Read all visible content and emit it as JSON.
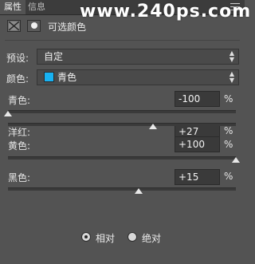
{
  "tabs": [
    {
      "label": "属性",
      "active": true
    },
    {
      "label": "信息",
      "active": false
    }
  ],
  "watermark": "www.240ps.com",
  "header": {
    "title": "可选颜色",
    "adjustment_icon": "selective-color-icon",
    "mask_icon": "layer-mask-icon"
  },
  "preset": {
    "label": "预设:",
    "value": "自定"
  },
  "colors": {
    "label": "颜色:",
    "value": "青色",
    "swatch_color": "#18b2f2"
  },
  "sliders": [
    {
      "label": "青色:",
      "value": "-100",
      "unit": "%",
      "level": -100
    },
    {
      "label": "洋红:",
      "value": "+27",
      "unit": "%",
      "level": 27
    },
    {
      "label": "黄色:",
      "value": "+100",
      "unit": "%",
      "level": 100
    },
    {
      "label": "黑色:",
      "value": "+15",
      "unit": "%",
      "level": 15
    }
  ],
  "method": {
    "options": [
      {
        "label": "相对",
        "checked": true
      },
      {
        "label": "绝对",
        "checked": false
      }
    ]
  }
}
